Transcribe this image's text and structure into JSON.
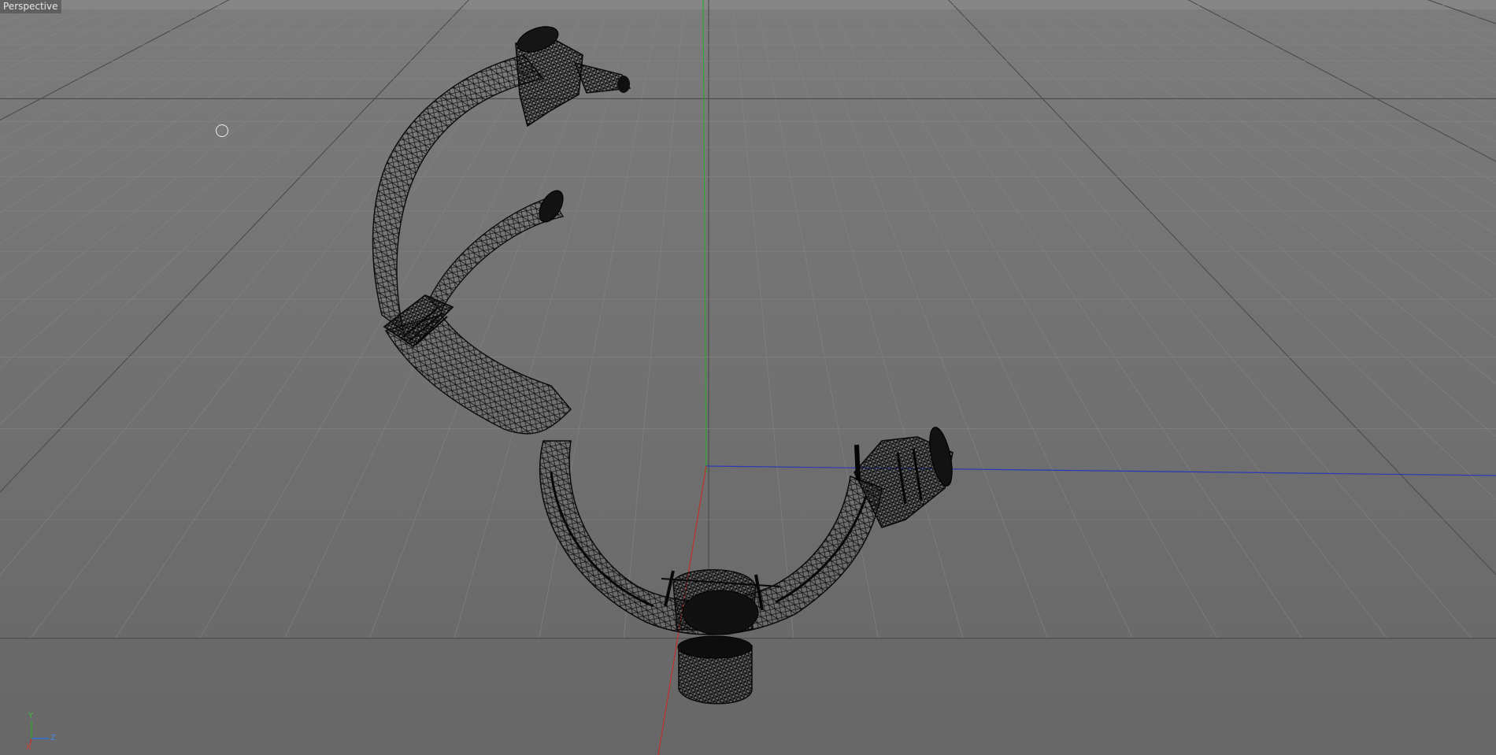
{
  "viewport": {
    "title": "Perspective",
    "colors": {
      "background_top": "#7c7c7c",
      "background_bottom": "#676767",
      "grid_minor": "#858585",
      "grid_major": "#4a4a4a",
      "axis_x": "#c0302a",
      "axis_y": "#2ea82e",
      "axis_z": "#2838b8",
      "wireframe": "#0a0a0a"
    },
    "cursor_icon": "circle-cursor-icon"
  },
  "gizmo": {
    "y_label": "Y",
    "z_label": "Z",
    "x_label": "X"
  }
}
